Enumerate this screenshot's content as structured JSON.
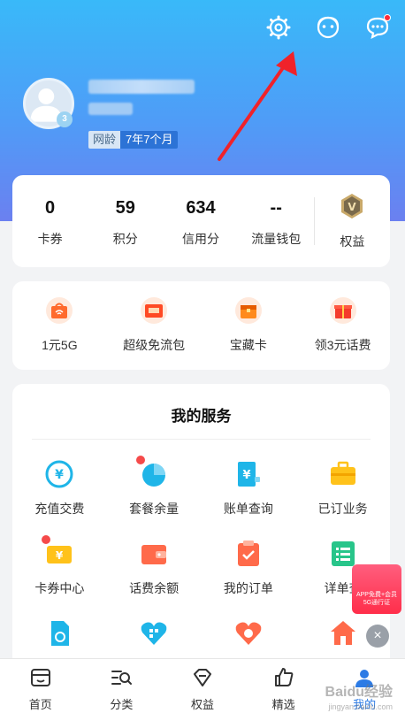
{
  "header": {
    "age_key": "网龄",
    "age_value": "7年7个月",
    "avatar_level": "3"
  },
  "stats": [
    {
      "num": "0",
      "label": "卡券"
    },
    {
      "num": "59",
      "label": "积分"
    },
    {
      "num": "634",
      "label": "信用分"
    },
    {
      "num": "--",
      "label": "流量钱包"
    }
  ],
  "rights": {
    "label": "权益",
    "badge_letter": "V"
  },
  "promos": [
    {
      "label": "1元5G",
      "icon": "wifi-bag-icon"
    },
    {
      "label": "超级免流包",
      "icon": "gift-box-icon"
    },
    {
      "label": "宝藏卡",
      "icon": "treasure-card-icon"
    },
    {
      "label": "领3元话费",
      "icon": "red-gift-icon"
    }
  ],
  "services": {
    "title": "我的服务",
    "items": [
      {
        "label": "充值交费",
        "icon": "recharge-icon",
        "dot": false
      },
      {
        "label": "套餐余量",
        "icon": "pie-chart-icon",
        "dot": true
      },
      {
        "label": "账单查询",
        "icon": "bill-icon",
        "dot": false
      },
      {
        "label": "已订业务",
        "icon": "briefcase-icon",
        "dot": false
      },
      {
        "label": "卡券中心",
        "icon": "coupon-icon",
        "dot": true
      },
      {
        "label": "话费余额",
        "icon": "wallet-icon",
        "dot": false
      },
      {
        "label": "我的订单",
        "icon": "order-icon",
        "dot": false
      },
      {
        "label": "详单查",
        "icon": "detail-list-icon",
        "dot": false
      },
      {
        "label": "",
        "icon": "sim-card-icon",
        "dot": false
      },
      {
        "label": "",
        "icon": "heart-qr-icon",
        "dot": false
      },
      {
        "label": "",
        "icon": "heart-face-icon",
        "dot": false
      },
      {
        "label": "",
        "icon": "home-icon",
        "dot": false
      }
    ]
  },
  "float_ad": {
    "line1": "APP免费+会员",
    "line2": "5G通行证"
  },
  "tabbar": [
    {
      "label": "首页",
      "icon": "home-tab-icon"
    },
    {
      "label": "分类",
      "icon": "category-search-icon"
    },
    {
      "label": "权益",
      "icon": "diamond-icon"
    },
    {
      "label": "精选",
      "icon": "thumbs-up-icon"
    },
    {
      "label": "我的",
      "icon": "profile-icon"
    }
  ],
  "colors": {
    "accent": "#2c7be5",
    "header_top": "#39b9f9",
    "header_bottom": "#6b80f0",
    "notification_dot": "#ff2b3a"
  },
  "watermark": {
    "text": "Baidu经验",
    "sub": "jingyan.baidu.com"
  }
}
